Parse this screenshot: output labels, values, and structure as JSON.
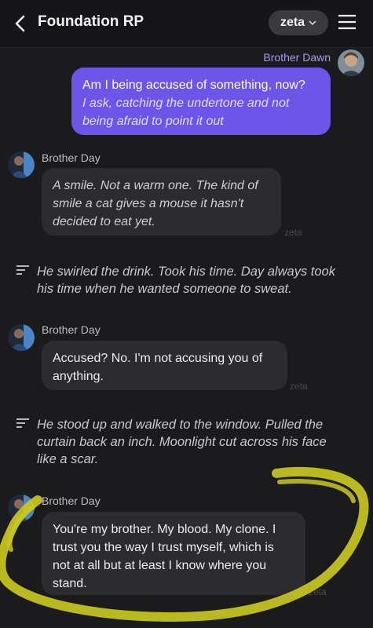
{
  "header": {
    "title": "Foundation RP",
    "model_label": "zeta"
  },
  "messages": [
    {
      "sender": "Brother Dawn",
      "speech": "Am I being accused of something, now?",
      "action": "I ask, catching the undertone and not being afraid to point it out"
    },
    {
      "sender": "Brother Day",
      "action": "A smile. Not a warm one. The kind of smile a cat gives a mouse it hasn't decided to eat yet.",
      "tag": "zeta"
    },
    {
      "narration": "He swirled the drink. Took his time. Day always took his time when he wanted someone to sweat."
    },
    {
      "sender": "Brother Day",
      "speech": "Accused? No. I'm not accusing you of anything.",
      "tag": "zeta"
    },
    {
      "narration": "He stood up and walked to the window. Pulled the curtain back an inch. Moonlight cut across his face like a scar."
    },
    {
      "sender": "Brother Day",
      "speech": "You're my brother. My blood. My clone. I trust you the way I trust myself, which is not at all but at least I know where you stand.",
      "tag": "zeta"
    }
  ],
  "colors": {
    "background": "#1b1b1d",
    "user_bubble": "#6c55e8",
    "bot_bubble": "#2c2c2f",
    "highlight_marker": "#c8c81e"
  },
  "icons": [
    "back-arrow-icon",
    "chevron-down-icon",
    "menu-icon",
    "narration-icon"
  ]
}
